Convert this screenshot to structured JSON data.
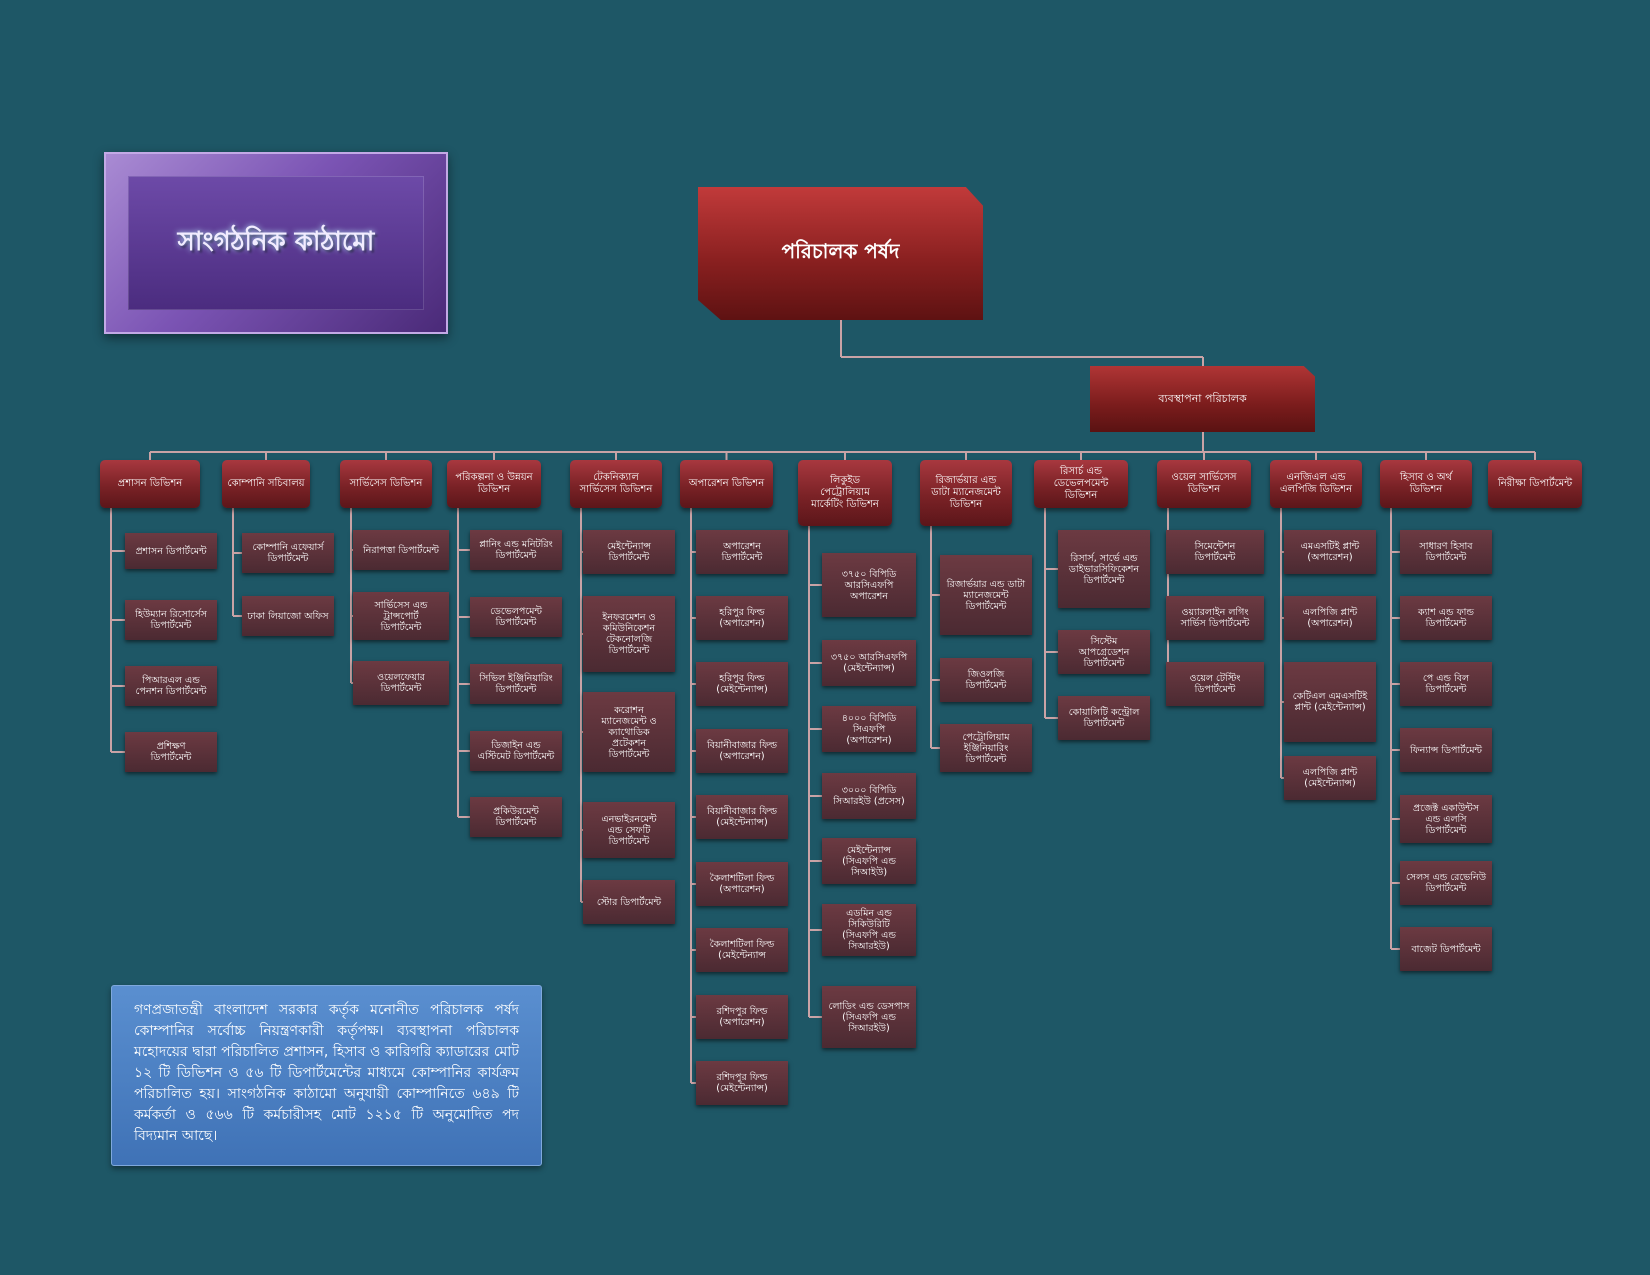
{
  "title": "সাংগঠনিক কাঠামো",
  "board": "পরিচালক পর্ষদ",
  "managing_director": "ব্যবস্থাপনা পরিচালক",
  "info_text": "গণপ্রজাতন্ত্রী বাংলাদেশ সরকার কর্তৃক মনোনীত পরিচালক পর্ষদ কোম্পানির সর্বোচ্চ নিয়ন্ত্রণকারী কর্তৃপক্ষ। ব্যবস্থাপনা পরিচালক মহোদয়ের দ্বারা পরিচালিত প্রশাসন, হিসাব ও কারিগরি ক্যাডারের মোট ১২ টি ডিভিশন ও ৫৬ টি ডিপার্টমেন্টের মাধ্যমে কোম্পানির কার্যক্রম পরিচালিত হয়। সাংগঠনিক কাঠামো অনুযায়ী কোম্পানিতে ৬৪৯ টি কর্মকর্তা ও ৫৬৬ টি কর্মচারীসহ মোট ১২১৫ টি অনুমোদিত পদ বিদ্যমান আছে।",
  "colors": {
    "background": "#1e5766",
    "connector": "#c9a3a6",
    "division_fill": "#7a2226",
    "department_fill": "#4b2a32"
  },
  "divisions": [
    {
      "label": "প্রশাসন ডিভিশন",
      "departments": [
        "প্রশাসন ডিপার্টমেন্ট",
        "হিউম্যান রিসোর্সেস\nডিপার্টমেন্ট",
        "পিআরএল এন্ড\nপেনশন ডিপার্টমেন্ট",
        "প্রশিক্ষণ\nডিপার্টমেন্ট"
      ]
    },
    {
      "label": "কোম্পানি সচিবালয়",
      "departments": [
        "কোম্পানি এফেয়ার্স\nডিপার্টমেন্ট",
        "ঢাকা লিয়াজো অফিস"
      ]
    },
    {
      "label": "সার্ভিসেস ডিভিশন",
      "departments": [
        "নিরাপত্তা ডিপার্টমেন্ট",
        "সার্ভিসেস এন্ড\nট্রান্সপোর্ট\nডিপার্টমেন্ট",
        "ওয়েলফেয়ার\nডিপার্টমেন্ট"
      ]
    },
    {
      "label": "পরিকল্পনা ও উন্নয়ন\nডিভিশন",
      "departments": [
        "প্লানিং এন্ড মনিটরিং\nডিপার্টমেন্ট",
        "ডেভেলপমেন্ট\nডিপার্টমেন্ট",
        "সিভিল ইঞ্জিনিয়ারিং\nডিপার্টমেন্ট",
        "ডিজাইন এন্ড\nএস্টিমেট ডিপার্টমেন্ট",
        "প্রকিউরমেন্ট\nডিপার্টমেন্ট"
      ]
    },
    {
      "label": "টেকনিক্যাল\nসার্ভিসেস ডিভিশন",
      "departments": [
        "মেইন্টেন্যান্স\nডিপার্টমেন্ট",
        "ইনফরমেশন ও\nকমিউনিকেশন\nটেকনোলজি\nডিপার্টমেন্ট",
        "করোশন\nম্যানেজমেন্ট ও\nক্যাথোডিক\nপ্রটেকশন\nডিপার্টমেন্ট",
        "এনভাইরনমেন্ট\nএন্ড সেফটি\nডিপার্টমেন্ট",
        "স্টোর ডিপার্টমেন্ট"
      ]
    },
    {
      "label": "অপারেশন ডিভিশন",
      "departments": [
        "অপারেশন\nডিপার্টমেন্ট",
        "হরিপুর ফিল্ড\n(অপারেশন)",
        "হরিপুর ফিল্ড\n(মেইন্টেন্যান্স)",
        "বিয়ানীবাজার ফিল্ড\n(অপারেশন)",
        "বিয়ানীবাজার ফিল্ড\n(মেইন্টেন্যান্স)",
        "কৈলাশটিলা ফিল্ড\n(অপারেশন)",
        "কৈলাশটিলা ফিল্ড\n(মেইন্টেন্যান্স",
        "রশিদপুর ফিল্ড\n(অপারেশন)",
        "রশিদপুর ফিল্ড\n(মেইন্টেন্যান্স)"
      ]
    },
    {
      "label": "লিকুইড\nপেট্রোলিয়াম\nমার্কেটিং ডিভিশন",
      "departments": [
        "৩৭৫০ বিপিডি\nআরসিএফপি\nঅপারেশন",
        "৩৭৫০ আরসিএফপি\n(মেইন্টেন্যান্স)",
        "৪০০০ বিপিডি\nসিএফপি\n(অপারেশন)",
        "৩০০০ বিপিডি\nসিআরইউ (প্রসেস)",
        "মেইন্টেন্যান্স\n(সিএফপি এন্ড\nসিআইউ)",
        "এডমিন এন্ড সিকিউরিটি\n(সিএফপি এন্ড সিআরইউ)",
        "লোডিং এন্ড ডেসপাস\n(সিএফপি এন্ড সিআরইউ)"
      ]
    },
    {
      "label": "রিজার্ভয়ার এন্ড\nডাটা ম্যানেজমেন্ট\nডিভিশন",
      "departments": [
        "রিজার্ভয়ার এন্ড ডাটা\nম্যানেজমেন্ট\nডিপার্টমেন্ট",
        "জিওলজি\nডিপার্টমেন্ট",
        "পেট্রোলিয়াম\nইঞ্জিনিয়ারিং\nডিপার্টমেন্ট"
      ]
    },
    {
      "label": "রিসার্চ এন্ড\nডেভেলপমেন্ট\nডিভিশন",
      "departments": [
        "রিসার্স, সার্ভে এন্ড\nডাইভারসিফিকেশন\nডিপার্টমেন্ট",
        "সিস্টেম\nআপগ্রেডেশন\nডিপার্টমেন্ট",
        "কোয়ালিটি কন্ট্রোল\nডিপার্টমেন্ট"
      ]
    },
    {
      "label": "ওয়েল সার্ভিসেস\nডিভিশন",
      "departments": [
        "সিমেন্টেশন\nডিপার্টমেন্ট",
        "ওয়্যারলাইন লগিং\nসার্ভিস ডিপার্টমেন্ট",
        "ওয়েল টেস্টিং\nডিপার্টমেন্ট"
      ]
    },
    {
      "label": "এনজিএল এন্ড\nএলপিজি ডিভিশন",
      "departments": [
        "এমএসটিই প্লান্ট\n(অপারেশন)",
        "এলপিজি প্লান্ট\n(অপারেশন)",
        "কেটিএল এমএসটিই\nপ্লান্ট (মেইন্টেন্যান্স)",
        "এলপিজি প্লান্ট\n(মেইন্টেন্যান্স)"
      ]
    },
    {
      "label": "হিসাব ও অর্থ\nডিভিশন",
      "departments": [
        "সাধারণ হিসাব\nডিপার্টমেন্ট",
        "ক্যাশ এন্ড ফান্ড\nডিপার্টমেন্ট",
        "পে এন্ড বিল\nডিপার্টমেন্ট",
        "ফিন্যান্স ডিপার্টমেন্ট",
        "প্রজেক্ট একাউন্টস\nএন্ড এলসি\nডিপার্টমেন্ট",
        "সেলস এন্ড রেভেনিউ\nডিপার্টমেন্ট",
        "বাজেট ডিপার্টমেন্ট"
      ]
    },
    {
      "label": "নিরীক্ষা ডিপার্টমেন্ট",
      "departments": []
    }
  ]
}
